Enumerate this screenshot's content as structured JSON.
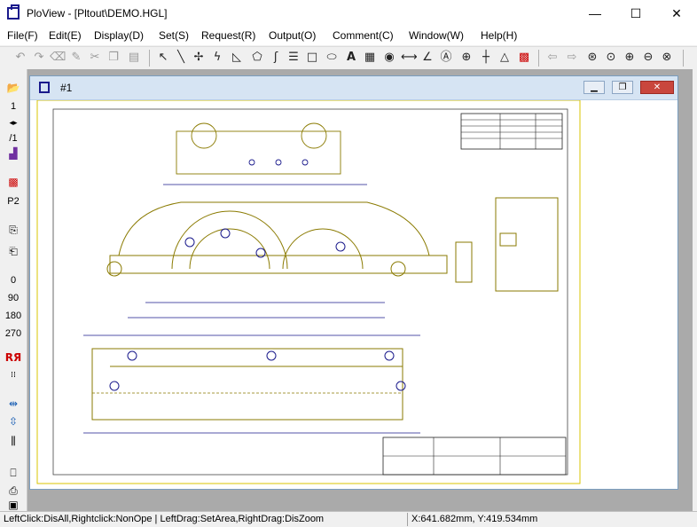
{
  "window": {
    "title": "PloView - [Pltout\\DEMO.HGL]"
  },
  "menu": [
    "File(F)",
    "Edit(E)",
    "Display(D)",
    "Set(S)",
    "Request(R)",
    "Output(O)",
    "Comment(C)",
    "Window(W)",
    "Help(H)"
  ],
  "toolbar_icons": [
    "undo-icon",
    "redo-icon",
    "eraser-icon",
    "brush-icon",
    "cut-icon",
    "copy-icon",
    "paste-icon",
    "select-arrow-icon",
    "line-icon",
    "cross-icon",
    "freehand-icon",
    "arc-icon",
    "polygon-icon",
    "curve-icon",
    "multiline-icon",
    "rectangle-icon",
    "ellipse-icon",
    "text-icon",
    "hatch-icon",
    "circle-mark-icon",
    "dimension-icon",
    "angle-icon",
    "label-icon",
    "point-icon",
    "measure-icon",
    "triangle-icon",
    "color-icon",
    "prev-view-icon",
    "next-view-icon",
    "zoom-area-icon",
    "zoom-fit-icon",
    "zoom-in-icon",
    "zoom-out-icon",
    "zoom-reset-icon"
  ],
  "left": {
    "page_current": "1",
    "page_total": "/1",
    "plot_label": "P2",
    "rotations": [
      "0",
      "90",
      "180",
      "270"
    ]
  },
  "child": {
    "title": "#1"
  },
  "status": {
    "hint": "LeftClick:DisAll,Rightclick:NonOpe  |  LeftDrag:SetArea,RightDrag:DisZoom",
    "coords": "X:641.682mm, Y:419.534mm"
  }
}
